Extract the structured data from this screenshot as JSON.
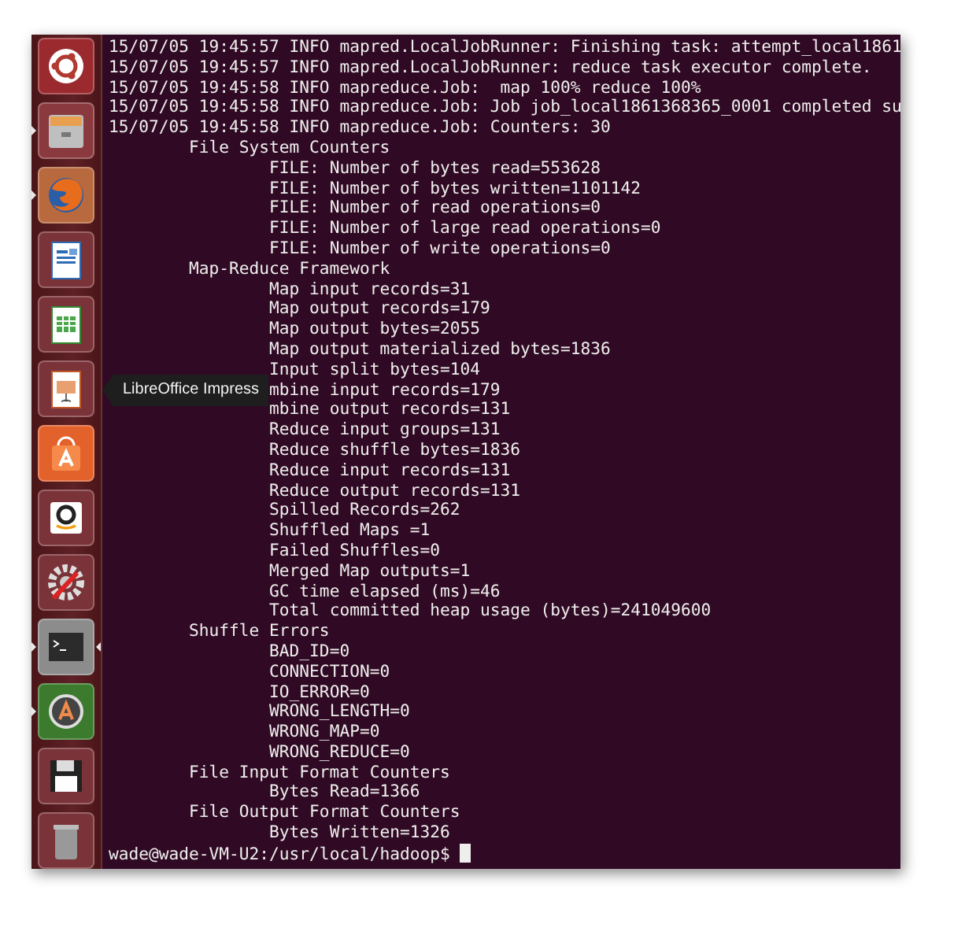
{
  "launcher": {
    "items": [
      {
        "kind": "ubuntu",
        "running": false,
        "focused": false
      },
      {
        "kind": "files",
        "running": true,
        "focused": false
      },
      {
        "kind": "firefox",
        "running": true,
        "focused": false
      },
      {
        "kind": "writer",
        "running": false,
        "focused": false
      },
      {
        "kind": "calc",
        "running": false,
        "focused": false
      },
      {
        "kind": "impress",
        "running": false,
        "focused": false,
        "tooltip": "LibreOffice Impress"
      },
      {
        "kind": "software",
        "running": false,
        "focused": false
      },
      {
        "kind": "amazon",
        "running": false,
        "focused": false
      },
      {
        "kind": "settings",
        "running": false,
        "focused": false
      },
      {
        "kind": "terminal",
        "running": true,
        "focused": true
      },
      {
        "kind": "updater",
        "running": true,
        "focused": false
      },
      {
        "kind": "disk",
        "running": false,
        "focused": false
      },
      {
        "kind": "trash",
        "running": false,
        "focused": false
      }
    ]
  },
  "terminal": {
    "log_lines": [
      "15/07/05 19:45:57 INFO mapred.LocalJobRunner: Finishing task: attempt_local1861",
      "15/07/05 19:45:57 INFO mapred.LocalJobRunner: reduce task executor complete.",
      "15/07/05 19:45:58 INFO mapreduce.Job:  map 100% reduce 100%",
      "15/07/05 19:45:58 INFO mapreduce.Job: Job job_local1861368365_0001 completed su",
      "15/07/05 19:45:58 INFO mapreduce.Job: Counters: 30"
    ],
    "groups": [
      {
        "title": "File System Counters",
        "children": [
          "FILE: Number of bytes read=553628",
          "FILE: Number of bytes written=1101142",
          "FILE: Number of read operations=0",
          "FILE: Number of large read operations=0",
          "FILE: Number of write operations=0"
        ]
      },
      {
        "title": "Map-Reduce Framework",
        "children": [
          "Map input records=31",
          "Map output records=179",
          "Map output bytes=2055",
          "Map output materialized bytes=1836",
          "Input split bytes=104",
          "mbine input records=179",
          "mbine output records=131",
          "Reduce input groups=131",
          "Reduce shuffle bytes=1836",
          "Reduce input records=131",
          "Reduce output records=131",
          "Spilled Records=262",
          "Shuffled Maps =1",
          "Failed Shuffles=0",
          "Merged Map outputs=1",
          "GC time elapsed (ms)=46",
          "Total committed heap usage (bytes)=241049600"
        ]
      },
      {
        "title": "Shuffle Errors",
        "children": [
          "BAD_ID=0",
          "CONNECTION=0",
          "IO_ERROR=0",
          "WRONG_LENGTH=0",
          "WRONG_MAP=0",
          "WRONG_REDUCE=0"
        ]
      },
      {
        "title": "File Input Format Counters",
        "children": [
          "Bytes Read=1366"
        ]
      },
      {
        "title": "File Output Format Counters",
        "children": [
          "Bytes Written=1326"
        ]
      }
    ],
    "prompt": "wade@wade-VM-U2:/usr/local/hadoop$"
  }
}
